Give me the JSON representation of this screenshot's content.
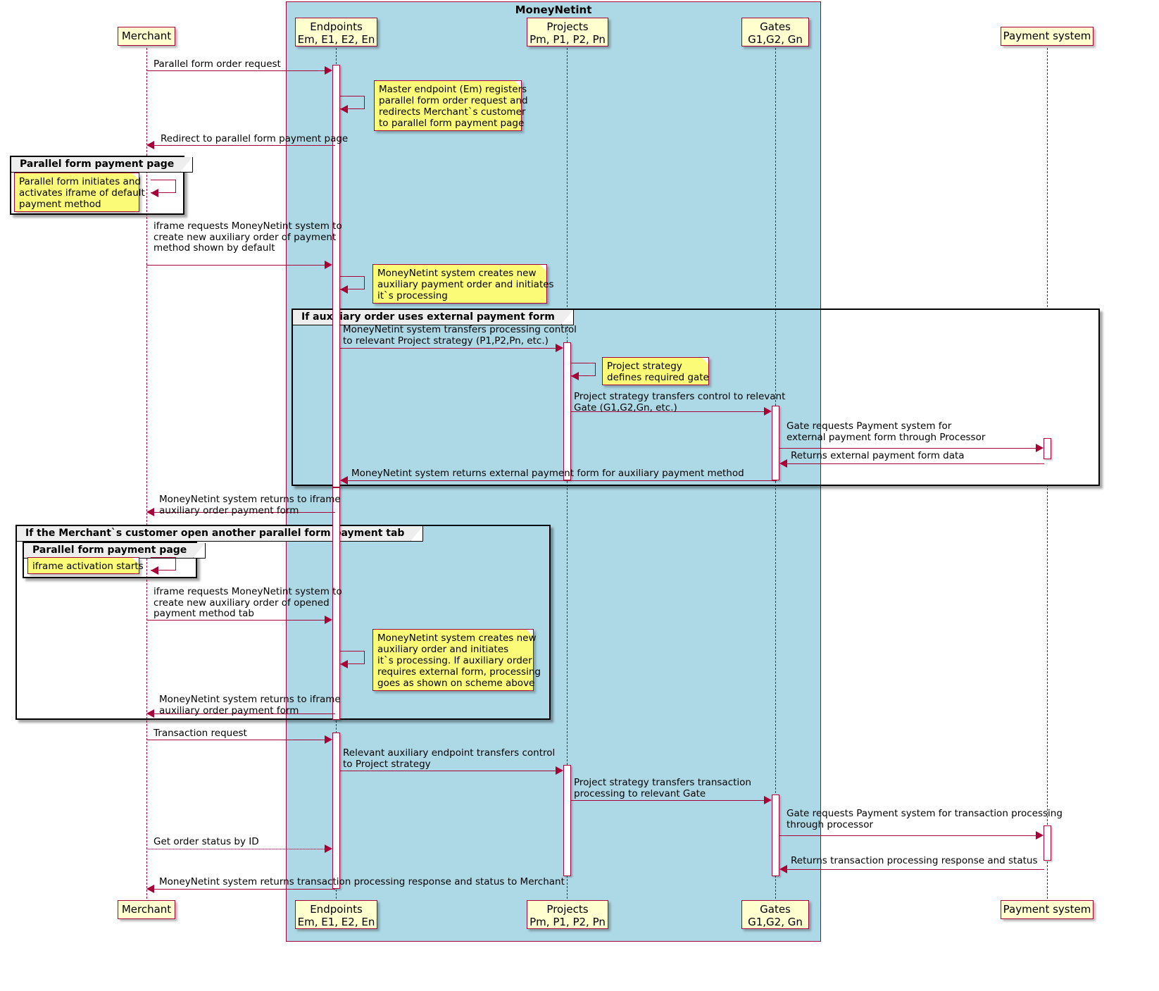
{
  "diagram": {
    "type": "sequence",
    "system_box_title": "MoneyNetint",
    "colors": {
      "system_box_fill": "#ADD8E6",
      "participant_fill": "#FEFECE",
      "note_fill": "#FBFB77",
      "line": "#A80036",
      "group_header_fill": "#EEEEEE"
    }
  },
  "participants": [
    {
      "id": "merchant",
      "line1": "Merchant",
      "line2": ""
    },
    {
      "id": "endpoints",
      "line1": "Endpoints",
      "line2": "Em, E1, E2, En"
    },
    {
      "id": "projects",
      "line1": "Projects",
      "line2": "Pm, P1, P2, Pn"
    },
    {
      "id": "gates",
      "line1": "Gates",
      "line2": "G1,G2, Gn"
    },
    {
      "id": "payment_system",
      "line1": "Payment system",
      "line2": ""
    }
  ],
  "groups": [
    {
      "id": "g1",
      "label": "Parallel form payment page"
    },
    {
      "id": "g2",
      "label": "If auxiliary order uses external payment form"
    },
    {
      "id": "g3",
      "label": "If the Merchant`s customer open another parallel form payment tab"
    },
    {
      "id": "g4",
      "label": "Parallel form payment page"
    }
  ],
  "messages": [
    {
      "id": "m1",
      "text": "Parallel form order request"
    },
    {
      "id": "m2",
      "text": "Redirect to parallel form payment page"
    },
    {
      "id": "m3",
      "text": "iframe requests MoneyNetint system to\ncreate new auxiliary order of payment\nmethod shown by default"
    },
    {
      "id": "m4",
      "text": "MoneyNetint system transfers processing control\nto relevant Project strategy (P1,P2,Pn, etc.)"
    },
    {
      "id": "m5",
      "text": "Project strategy transfers control to relevant\nGate (G1,G2,Gn, etc.)"
    },
    {
      "id": "m6",
      "text": "Gate requests Payment system for\nexternal payment form through Processor"
    },
    {
      "id": "m7",
      "text": "Returns external payment form data"
    },
    {
      "id": "m8",
      "text": "MoneyNetint system returns external payment form for auxiliary payment method"
    },
    {
      "id": "m9",
      "text": "MoneyNetint system returns to iframe\nauxiliary order payment form"
    },
    {
      "id": "m10",
      "text": "iframe requests MoneyNetint system to\ncreate new auxiliary order of opened\npayment method tab"
    },
    {
      "id": "m11",
      "text": "MoneyNetint system returns to iframe\nauxiliary order payment form"
    },
    {
      "id": "m12",
      "text": "Transaction request"
    },
    {
      "id": "m13",
      "text": "Relevant auxiliary endpoint transfers control\nto Project strategy"
    },
    {
      "id": "m14",
      "text": "Project strategy transfers transaction\nprocessing to relevant Gate"
    },
    {
      "id": "m15",
      "text": "Gate requests Payment system for transaction processing\nthrough processor"
    },
    {
      "id": "m16",
      "text": "Get order status by ID"
    },
    {
      "id": "m17",
      "text": "Returns transaction processing response and status"
    },
    {
      "id": "m18",
      "text": "MoneyNetint system returns transaction processing response and status to Merchant"
    }
  ],
  "notes": [
    {
      "id": "n1",
      "text": "Master endpoint (Em) registers\nparallel form order request and\nredirects Merchant`s customer\nto parallel form payment page"
    },
    {
      "id": "n2",
      "text": "Parallel form initiates and\nactivates iframe of default\npayment method"
    },
    {
      "id": "n3",
      "text": "MoneyNetint system creates new\nauxiliary payment order and initiates\nit`s processing"
    },
    {
      "id": "n4",
      "text": "Project strategy\ndefines required gate"
    },
    {
      "id": "n5",
      "text": "iframe activation starts"
    },
    {
      "id": "n6",
      "text": "MoneyNetint system creates new\nauxiliary order and initiates\nit`s processing. If auxiliary order\nrequires external form, processing\ngoes as shown on scheme above"
    }
  ]
}
